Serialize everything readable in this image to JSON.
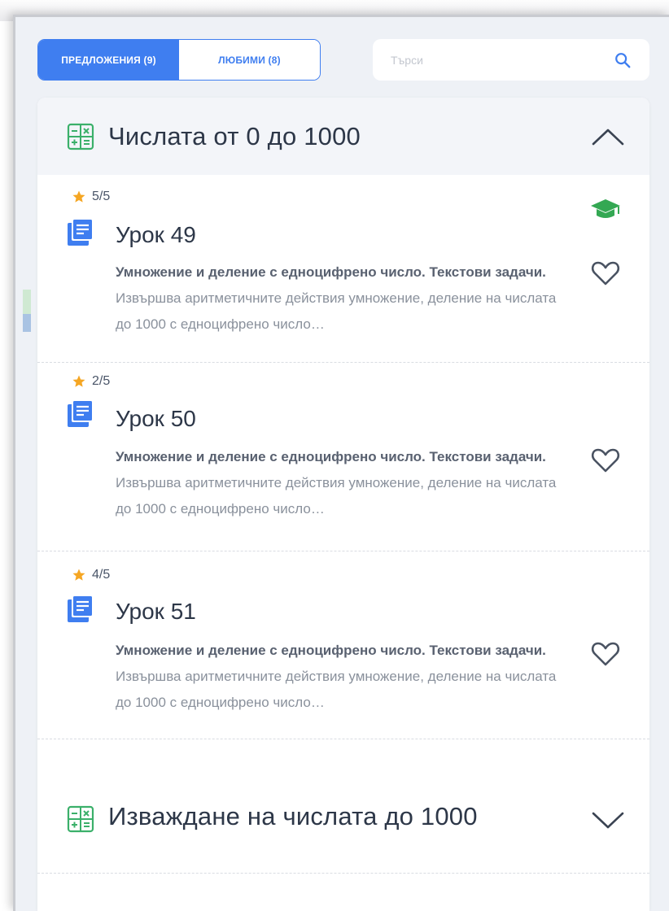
{
  "tabs": {
    "suggestions": "ПРЕДЛОЖЕНИЯ (9)",
    "favorites": "ЛЮБИМИ (8)"
  },
  "search": {
    "placeholder": "Търси"
  },
  "sections": [
    {
      "title": "Числата от 0 до 1000",
      "expanded": true
    },
    {
      "title": "Изваждане на числата до 1000",
      "expanded": false
    }
  ],
  "lessons": [
    {
      "rating": "5/5",
      "title": "Урок 49",
      "desc_bold": "Умножение и деление с едноцифрено число. Текстови задачи.",
      "desc_rest": "Извършва аритметичните действия умножение, деление на числата до 1000 с едноцифрено число…",
      "completed_icon": "graduation-cap-icon"
    },
    {
      "rating": "2/5",
      "title": "Урок 50",
      "desc_bold": "Умножение и деление с едноцифрено число. Текстови задачи.",
      "desc_rest": "Извършва аритметичните действия умножение, деление на числата до 1000 с едноцифрено число…"
    },
    {
      "rating": "4/5",
      "title": "Урок 51",
      "desc_bold": "Умножение и деление с едноцифрено число. Текстови задачи.",
      "desc_rest": "Извършва аритметичните действия умножение, деление на числата до 1000 с едноцифрено число…"
    }
  ],
  "colors": {
    "accent": "#3f7ef0",
    "star": "#f5a623",
    "calc_icon": "#3bb06a",
    "cap_icon": "#34a853",
    "doc_icon": "#3f7ef0"
  }
}
